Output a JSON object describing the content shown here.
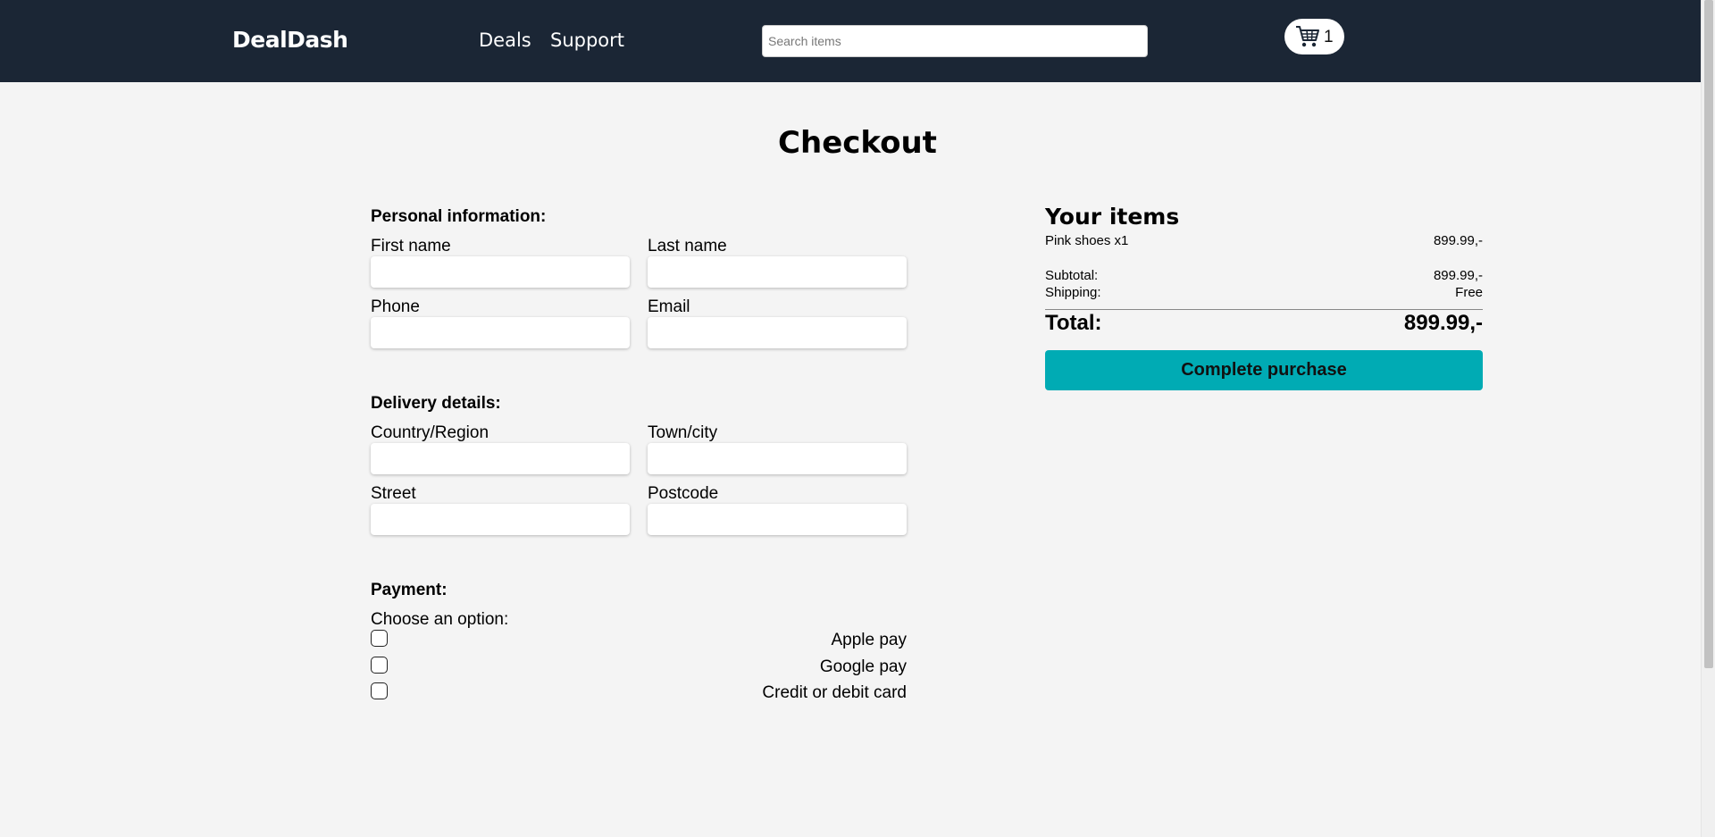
{
  "header": {
    "logo": "DealDash",
    "nav": [
      "Deals",
      "Support"
    ],
    "search_placeholder": "Search items",
    "cart_count": "1"
  },
  "page": {
    "title": "Checkout"
  },
  "personal": {
    "title": "Personal information:",
    "first_name": "First name",
    "last_name": "Last name",
    "phone": "Phone",
    "email": "Email"
  },
  "delivery": {
    "title": "Delivery details:",
    "country": "Country/Region",
    "town": "Town/city",
    "street": "Street",
    "postcode": "Postcode"
  },
  "payment": {
    "title": "Payment:",
    "prompt": "Choose an option:",
    "options": [
      "Apple pay",
      "Google pay",
      "Credit or debit card"
    ]
  },
  "summary": {
    "title": "Your items",
    "item_name": "Pink shoes x1",
    "item_price": "899.99,-",
    "subtotal_label": "Subtotal:",
    "subtotal_value": "899.99,-",
    "shipping_label": "Shipping:",
    "shipping_value": "Free",
    "total_label": "Total:",
    "total_value": "899.99,-",
    "button": "Complete purchase"
  },
  "colors": {
    "header_bg": "#1b2635",
    "page_bg": "#f4f4f4",
    "accent": "#00abb4"
  },
  "icons": {
    "cart": "cart-icon"
  }
}
